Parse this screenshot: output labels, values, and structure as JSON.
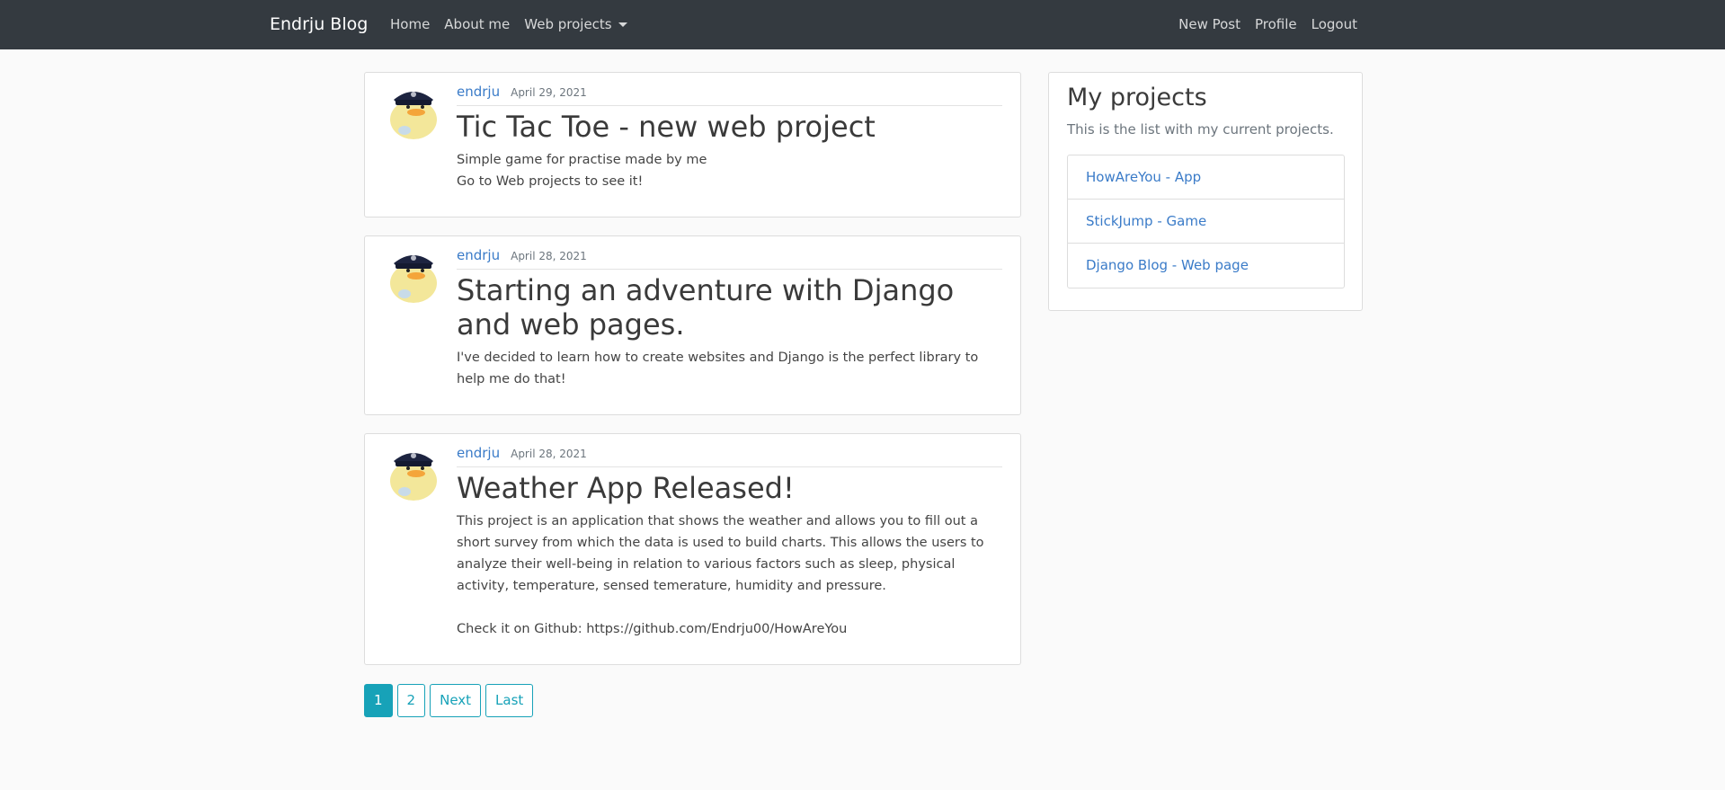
{
  "navbar": {
    "brand": "Endrju Blog",
    "links": {
      "home": "Home",
      "about": "About me",
      "projects": "Web projects"
    },
    "right": {
      "new_post": "New Post",
      "profile": "Profile",
      "logout": "Logout"
    }
  },
  "posts": [
    {
      "author": "endrju",
      "date": "April 29, 2021",
      "title": "Tic Tac Toe - new web project",
      "content": "Simple game for practise made by me\nGo to Web projects to see it!"
    },
    {
      "author": "endrju",
      "date": "April 28, 2021",
      "title": "Starting an adventure with Django and web pages.",
      "content": "I've decided to learn how to create websites and Django is the perfect library to help me do that!"
    },
    {
      "author": "endrju",
      "date": "April 28, 2021",
      "title": "Weather App Released!",
      "content": "This project is an application that shows the weather and allows you to fill out a short survey from which the data is used to build charts. This allows the users to analyze their well-being in relation to various factors such as sleep, physical activity, temperature, sensed temerature, humidity and pressure.\n\nCheck it on Github: https://github.com/Endrju00/HowAreYou"
    }
  ],
  "pagination": {
    "page1": "1",
    "page2": "2",
    "next": "Next",
    "last": "Last"
  },
  "sidebar": {
    "title": "My projects",
    "subtitle": "This is the list with my current projects.",
    "projects": [
      "HowAreYou - App",
      "StickJump - Game",
      "Django Blog - Web page"
    ]
  },
  "colors": {
    "navbar_bg": "#343a40",
    "accent": "#17a2b8",
    "link": "#3a7bc8"
  },
  "icons": {
    "avatar": "duck-police-avatar",
    "dropdown": "caret-down-icon"
  }
}
